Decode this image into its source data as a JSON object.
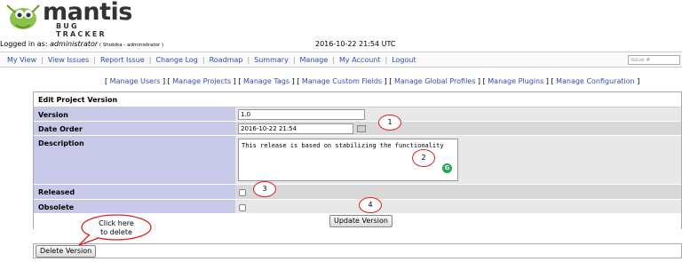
{
  "logo": {
    "text": "mantis",
    "subtext": "BUG TRACKER"
  },
  "login": {
    "prefix": "Logged in as: ",
    "username": "administrator",
    "detail": " ( Shobika - administrator )"
  },
  "clock": "2016-10-22 21:54 UTC",
  "menu": {
    "items": [
      "My View",
      "View Issues",
      "Report Issue",
      "Change Log",
      "Roadmap",
      "Summary",
      "Manage",
      "My Account",
      "Logout"
    ],
    "issue_placeholder": "Issue #"
  },
  "submenu": {
    "items": [
      "Manage Users",
      "Manage Projects",
      "Manage Tags",
      "Manage Custom Fields",
      "Manage Global Profiles",
      "Manage Plugins",
      "Manage Configuration"
    ]
  },
  "form": {
    "title": "Edit Project Version",
    "version_label": "Version",
    "version_value": "1.0",
    "date_label": "Date Order",
    "date_value": "2016-10-22 21:54",
    "description_label": "Description",
    "description_value": "This release is based on stabilizing the functionality",
    "released_label": "Released",
    "obsolete_label": "Obsolete",
    "update_button": "Update Version"
  },
  "delete": {
    "button": "Delete Version"
  },
  "annotations": {
    "n1": "1",
    "n2": "2",
    "n3": "3",
    "n4": "4",
    "callout_line1": "Click here",
    "callout_line2": "to delete",
    "color": "#e02020"
  }
}
